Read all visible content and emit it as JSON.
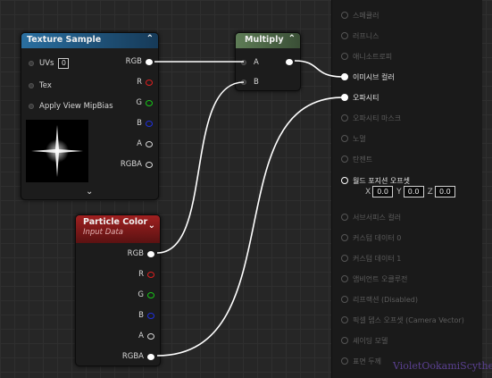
{
  "texture_sample": {
    "title": "Texture Sample",
    "inputs": [
      {
        "label": "UVs",
        "value": "0"
      },
      {
        "label": "Tex"
      },
      {
        "label": "Apply View MipBias"
      }
    ],
    "outputs": [
      "RGB",
      "R",
      "G",
      "B",
      "A",
      "RGBA"
    ],
    "expand_icon": "chevron-down-icon"
  },
  "multiply": {
    "title": "Multiply",
    "inputs": [
      "A",
      "B"
    ]
  },
  "particle_color": {
    "title": "Particle Color",
    "subtitle": "Input Data",
    "outputs": [
      "RGB",
      "R",
      "G",
      "B",
      "A",
      "RGBA"
    ]
  },
  "material_output": {
    "pins": [
      {
        "label": "스페큘러",
        "active": false
      },
      {
        "label": "러프니스",
        "active": false
      },
      {
        "label": "애니소트로피",
        "active": false
      },
      {
        "label": "이미시브 컬러",
        "active": true
      },
      {
        "label": "오파시티",
        "active": true
      },
      {
        "label": "오파시티 마스크",
        "active": false
      },
      {
        "label": "노멀",
        "active": false
      },
      {
        "label": "탄젠트",
        "active": false
      },
      {
        "label": "월드 포지션 오프셋",
        "active": true
      },
      {
        "label": "서브서피스 컬러",
        "active": false
      },
      {
        "label": "커스텀 데이터 0",
        "active": false
      },
      {
        "label": "커스텀 데이터 1",
        "active": false
      },
      {
        "label": "앰비언트 오클루전",
        "active": false
      },
      {
        "label": "리프랙션 (Disabled)",
        "active": false
      },
      {
        "label": "픽셀 뎁스 오프셋 (Camera Vector)",
        "active": false
      },
      {
        "label": "셰이딩 모델",
        "active": false
      },
      {
        "label": "표면 두께",
        "active": false
      }
    ],
    "wpo_vector": {
      "x_label": "X",
      "x": "0.0",
      "y_label": "Y",
      "y": "0.0",
      "z_label": "Z",
      "z": "0.0"
    }
  },
  "watermark": "VioletOokamiScythe",
  "colors": {
    "texture_header": "#1f5a86",
    "multiply_header": "#50704a",
    "particle_header": "#8a1e1e"
  }
}
